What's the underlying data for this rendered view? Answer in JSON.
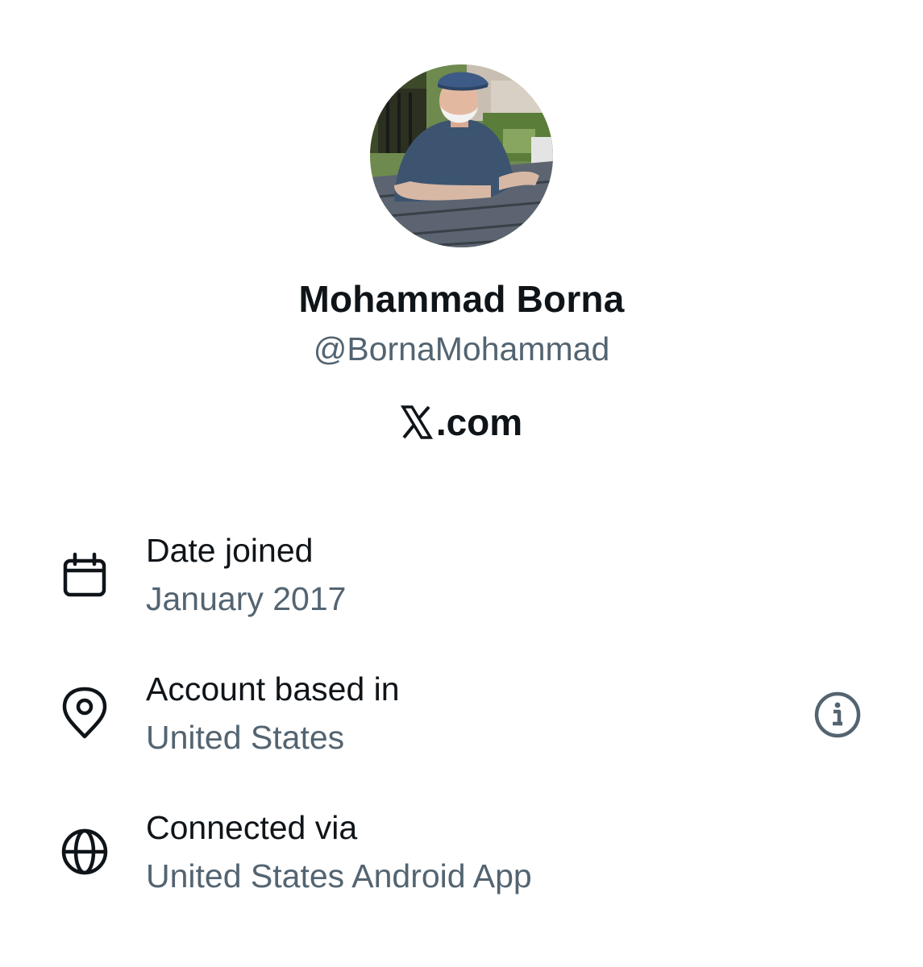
{
  "profile": {
    "display_name": "Mohammad Borna",
    "handle": "@BornaMohammad",
    "avatar_icon": "profile-photo"
  },
  "brand": {
    "logo_icon": "x-logo-icon",
    "suffix": ".com"
  },
  "details": [
    {
      "icon": "calendar-icon",
      "label": "Date joined",
      "value": "January 2017"
    },
    {
      "icon": "location-pin-icon",
      "label": "Account based in",
      "value": "United States",
      "action_icon": "info-icon"
    },
    {
      "icon": "globe-icon",
      "label": "Connected via",
      "value": "United States Android App"
    }
  ],
  "colors": {
    "primary_text": "#0f1419",
    "secondary_text": "#536471",
    "background": "#ffffff"
  }
}
